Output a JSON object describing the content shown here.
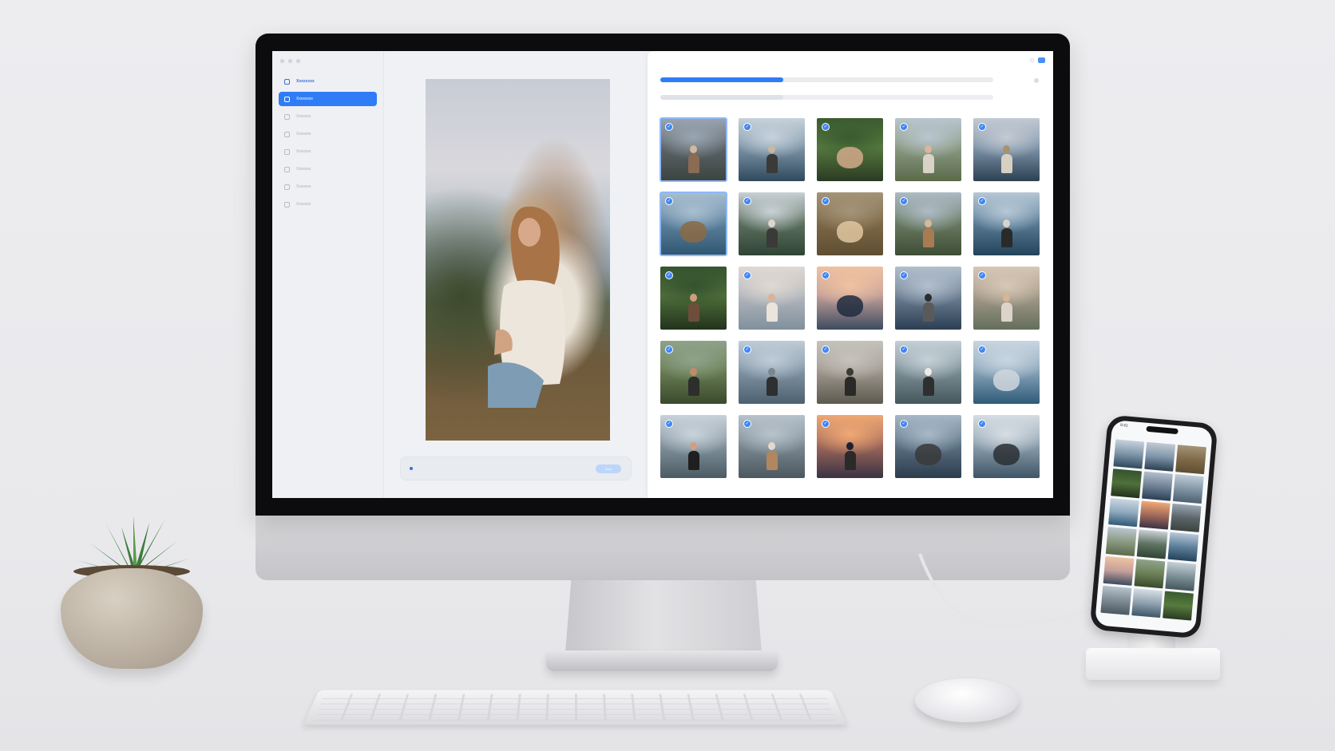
{
  "app": {
    "sidebar": {
      "items": [
        {
          "label": "Xxxxxxxx",
          "icon": "folder-icon"
        },
        {
          "label": "Xxxxxxxx",
          "icon": "photos-icon"
        },
        {
          "label": "Xxxxxxx",
          "icon": "clock-icon"
        },
        {
          "label": "Xxxxxxx",
          "icon": "album-icon"
        },
        {
          "label": "Xxxxxxx",
          "icon": "album-icon"
        },
        {
          "label": "Xxxxxxx",
          "icon": "album-icon"
        },
        {
          "label": "Xxxxxxx",
          "icon": "album-icon"
        },
        {
          "label": "Xxxxxxx",
          "icon": "trash-icon"
        }
      ]
    },
    "preview": {
      "prompt_button": "Xxxx"
    },
    "progress": {
      "primary": 0.37,
      "secondary": 0.37
    },
    "accent_color": "#2f7cf6",
    "thumbnails": [
      {
        "scene": "woman-rocky-lake",
        "selected": true
      },
      {
        "scene": "person-on-lake",
        "selected": true
      },
      {
        "scene": "woman-tropical-leaves",
        "selected": true
      },
      {
        "scene": "woman-mountain-meadow",
        "selected": true
      },
      {
        "scene": "figure-on-rock-sea",
        "selected": true
      },
      {
        "scene": "island-on-lake",
        "selected": true
      },
      {
        "scene": "person-forest-lake",
        "selected": true
      },
      {
        "scene": "puppy-in-grass",
        "selected": true
      },
      {
        "scene": "woman-portrait-mountains",
        "selected": true
      },
      {
        "scene": "person-on-shore",
        "selected": true
      },
      {
        "scene": "woman-tropical-plants",
        "selected": true
      },
      {
        "scene": "woman-mist-sea",
        "selected": true
      },
      {
        "scene": "sunset-over-sea",
        "selected": true
      },
      {
        "scene": "person-on-rock-lake",
        "selected": true
      },
      {
        "scene": "woman-hillside-sea",
        "selected": true
      },
      {
        "scene": "woman-forest-path",
        "selected": true
      },
      {
        "scene": "person-road-mountains",
        "selected": true
      },
      {
        "scene": "person-misty-forest",
        "selected": true
      },
      {
        "scene": "woman-rocky-coast",
        "selected": true
      },
      {
        "scene": "figure-on-cliff",
        "selected": true
      },
      {
        "scene": "woman-lake-portrait",
        "selected": true
      },
      {
        "scene": "woman-with-dog",
        "selected": true
      },
      {
        "scene": "person-at-sunset",
        "selected": true
      },
      {
        "scene": "sea-stacks",
        "selected": true
      },
      {
        "scene": "rocky-coastline",
        "selected": true
      }
    ]
  },
  "phone": {
    "status_time": "9:41"
  }
}
